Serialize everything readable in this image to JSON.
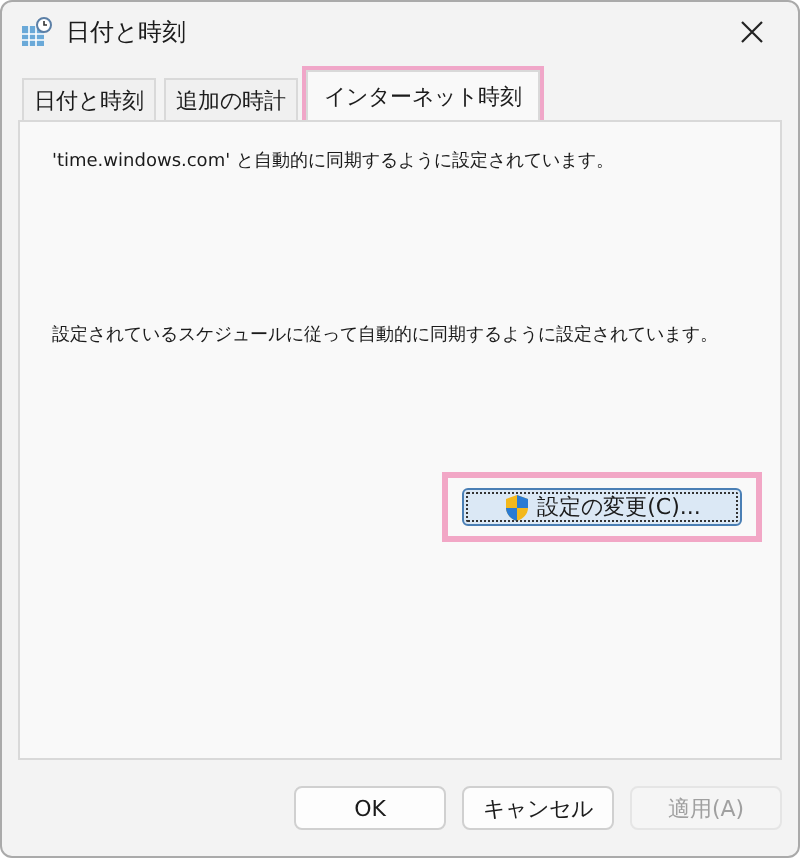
{
  "window": {
    "title": "日付と時刻"
  },
  "tabs": [
    {
      "label": "日付と時刻",
      "selected": false,
      "highlighted": false
    },
    {
      "label": "追加の時計",
      "selected": false,
      "highlighted": false
    },
    {
      "label": "インターネット時刻",
      "selected": true,
      "highlighted": true
    }
  ],
  "panel": {
    "sync_text": "'time.windows.com' と自動的に同期するように設定されています。",
    "schedule_text": "設定されているスケジュールに従って自動的に同期するように設定されています。",
    "change_button": {
      "label": "設定の変更(C)...",
      "highlighted": true
    }
  },
  "buttons": [
    {
      "label": "OK",
      "disabled": false
    },
    {
      "label": "キャンセル",
      "disabled": false
    },
    {
      "label": "適用(A)",
      "disabled": true
    }
  ]
}
